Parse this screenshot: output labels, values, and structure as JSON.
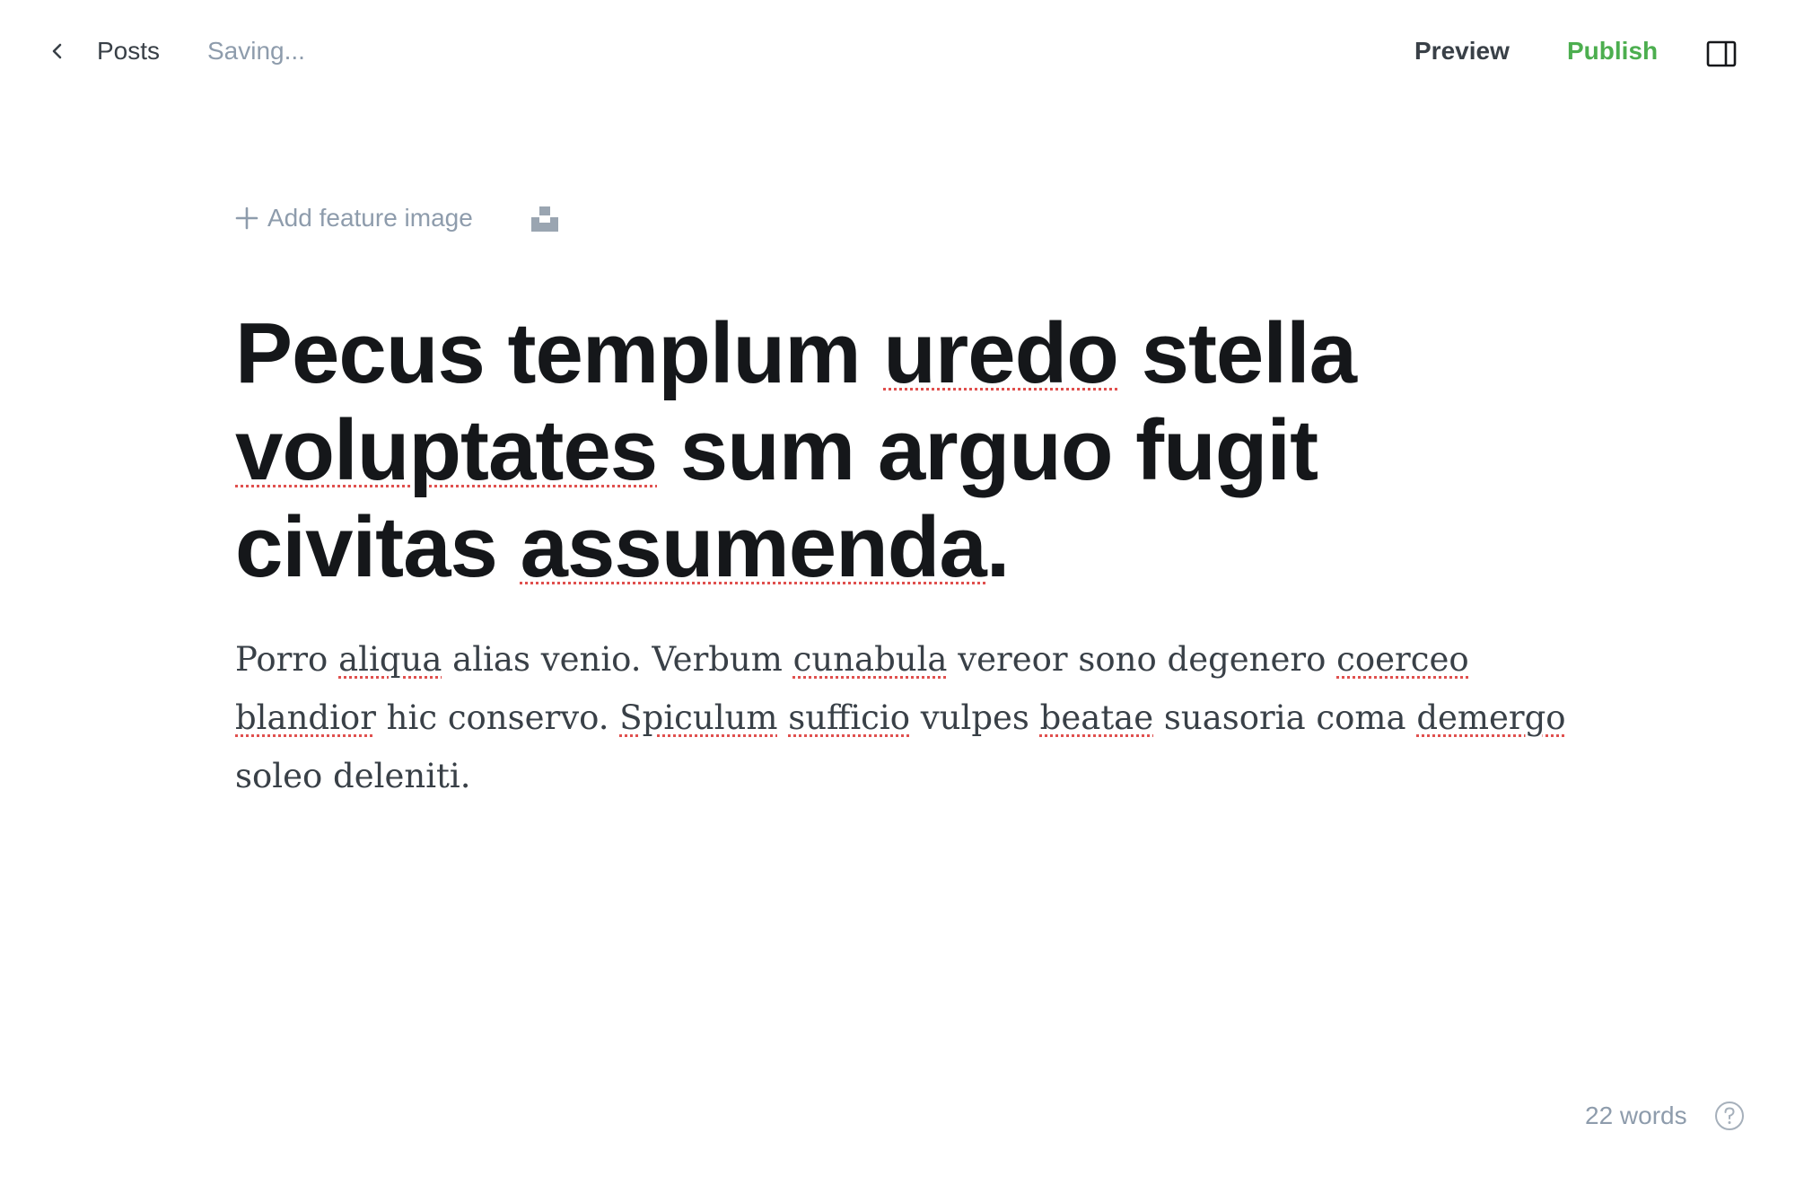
{
  "header": {
    "back_label": "Posts",
    "save_status": "Saving...",
    "preview_label": "Preview",
    "publish_label": "Publish",
    "back_icon": "chevron-left-icon",
    "sidebar_icon": "sidebar-panel-icon"
  },
  "feature_image": {
    "add_label": "Add feature image",
    "add_icon": "plus-icon",
    "unsplash_icon": "unsplash-icon"
  },
  "post": {
    "title_words": [
      {
        "text": "Pecus",
        "misspelled": false
      },
      {
        "text": "templum",
        "misspelled": false
      },
      {
        "text": "uredo",
        "misspelled": true
      },
      {
        "text": "stella",
        "misspelled": false
      },
      {
        "text": "voluptates",
        "misspelled": true
      },
      {
        "text": "sum",
        "misspelled": false
      },
      {
        "text": "arguo",
        "misspelled": false
      },
      {
        "text": "fugit",
        "misspelled": false
      },
      {
        "text": "civitas",
        "misspelled": false
      },
      {
        "text": "assumenda",
        "misspelled": true
      },
      {
        "text": ".",
        "misspelled": false,
        "attach": true
      }
    ],
    "body_words": [
      {
        "text": "Porro",
        "misspelled": false
      },
      {
        "text": "aliqua",
        "misspelled": true
      },
      {
        "text": "alias",
        "misspelled": false
      },
      {
        "text": "venio.",
        "misspelled": false
      },
      {
        "text": "Verbum",
        "misspelled": false
      },
      {
        "text": "cunabula",
        "misspelled": true
      },
      {
        "text": "vereor",
        "misspelled": false
      },
      {
        "text": "sono",
        "misspelled": false
      },
      {
        "text": "degenero",
        "misspelled": false
      },
      {
        "text": "coerceo",
        "misspelled": true
      },
      {
        "text": "blandior",
        "misspelled": true
      },
      {
        "text": "hic",
        "misspelled": false
      },
      {
        "text": "conservo.",
        "misspelled": false
      },
      {
        "text": "Spiculum",
        "misspelled": true
      },
      {
        "text": "sufficio",
        "misspelled": true
      },
      {
        "text": "vulpes",
        "misspelled": false
      },
      {
        "text": "beatae",
        "misspelled": true
      },
      {
        "text": "suasoria",
        "misspelled": false
      },
      {
        "text": "coma",
        "misspelled": false
      },
      {
        "text": "demergo",
        "misspelled": true
      },
      {
        "text": "soleo",
        "misspelled": false
      },
      {
        "text": "deleniti.",
        "misspelled": false
      }
    ]
  },
  "footer": {
    "word_count": "22 words",
    "help_icon": "help-circle-icon"
  },
  "colors": {
    "accent_green": "#4cae4f",
    "muted_text": "#8e9cac",
    "title_text": "#15171a",
    "body_text": "#394047",
    "spellcheck_red": "#e0504e"
  }
}
